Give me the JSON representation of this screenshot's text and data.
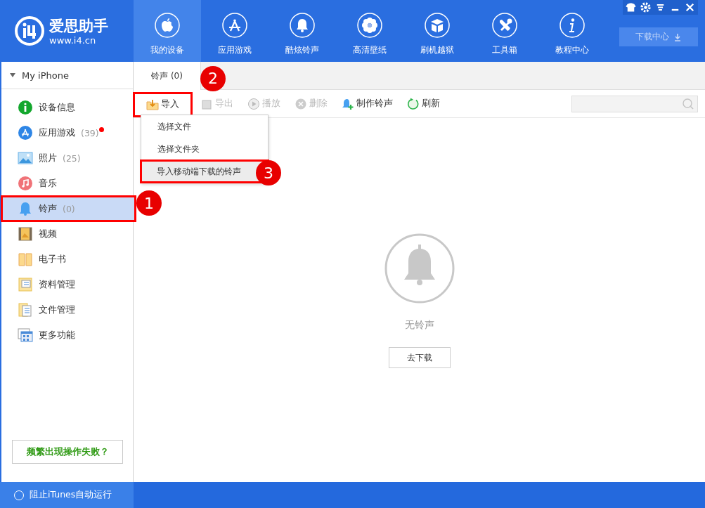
{
  "logo": {
    "name": "爱思助手",
    "url": "www.i4.cn"
  },
  "nav": [
    {
      "label": "我的设备",
      "selected": true,
      "kind": "apple"
    },
    {
      "label": "应用游戏",
      "selected": false,
      "kind": "store"
    },
    {
      "label": "酷炫铃声",
      "selected": false,
      "kind": "bell"
    },
    {
      "label": "高清壁纸",
      "selected": false,
      "kind": "flower"
    },
    {
      "label": "刷机越狱",
      "selected": false,
      "kind": "box"
    },
    {
      "label": "工具箱",
      "selected": false,
      "kind": "tools"
    },
    {
      "label": "教程中心",
      "selected": false,
      "kind": "info"
    }
  ],
  "download_center": {
    "label": "下载中心"
  },
  "device": {
    "name": "My iPhone",
    "expanded": true
  },
  "sidebar": {
    "items": [
      {
        "label": "设备信息",
        "selected": false,
        "kind": "info"
      },
      {
        "label": "应用游戏",
        "count": "(39)",
        "dot": true,
        "selected": false,
        "kind": "store"
      },
      {
        "label": "照片",
        "count": "(25)",
        "selected": false,
        "kind": "photo"
      },
      {
        "label": "音乐",
        "selected": false,
        "kind": "music"
      },
      {
        "label": "铃声",
        "count": "(0)",
        "selected": true,
        "kind": "bell",
        "callout": "1"
      },
      {
        "label": "视频",
        "selected": false,
        "kind": "video"
      },
      {
        "label": "电子书",
        "selected": false,
        "kind": "book"
      },
      {
        "label": "资料管理",
        "selected": false,
        "kind": "data"
      },
      {
        "label": "文件管理",
        "selected": false,
        "kind": "files"
      },
      {
        "label": "更多功能",
        "selected": false,
        "kind": "more"
      }
    ]
  },
  "help_button": "频繁出现操作失败？",
  "tabs": [
    {
      "label": "铃声 (0)",
      "selected": true
    }
  ],
  "toolbar": [
    {
      "label": "导入",
      "disabled": false,
      "kind": "import",
      "callout": "2"
    },
    {
      "label": "导出",
      "disabled": true,
      "kind": "export"
    },
    {
      "label": "播放",
      "disabled": true,
      "kind": "play"
    },
    {
      "label": "删除",
      "disabled": true,
      "kind": "delete"
    },
    {
      "label": "制作铃声",
      "disabled": false,
      "kind": "make"
    },
    {
      "label": "刷新",
      "disabled": false,
      "kind": "refresh"
    }
  ],
  "import_menu": {
    "items": [
      {
        "label": "选择文件",
        "highlighted": false
      },
      {
        "label": "选择文件夹",
        "highlighted": false
      },
      {
        "label": "导入移动端下载的铃声",
        "highlighted": true,
        "callout": "3"
      }
    ]
  },
  "empty": {
    "message": "无铃声",
    "button": "去下载"
  },
  "status_bar": {
    "label": "阻止iTunes自动运行",
    "checked": false
  }
}
